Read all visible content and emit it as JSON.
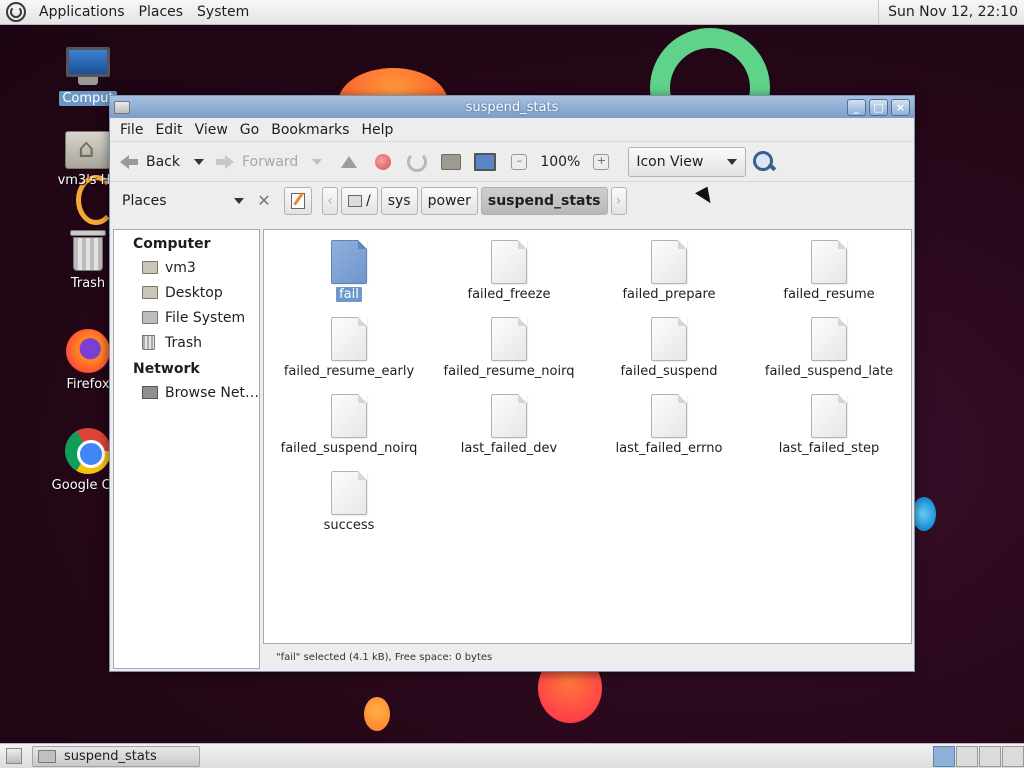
{
  "top_panel": {
    "menus": [
      "Applications",
      "Places",
      "System"
    ],
    "clock": "Sun Nov 12, 22:10"
  },
  "desktop": {
    "icons": [
      {
        "label": "Comput",
        "icon": "computer-icon"
      },
      {
        "label": "vm3's Ho",
        "icon": "home-folder-icon"
      },
      {
        "label": "Trash",
        "icon": "trash-icon"
      },
      {
        "label": "Firefox",
        "icon": "firefox-icon"
      },
      {
        "label": "Google Chr",
        "icon": "chrome-icon"
      }
    ]
  },
  "window": {
    "title": "suspend_stats",
    "menubar": [
      "File",
      "Edit",
      "View",
      "Go",
      "Bookmarks",
      "Help"
    ],
    "toolbar": {
      "back": "Back",
      "forward": "Forward",
      "zoom": "100%",
      "view_mode": "Icon View"
    },
    "location": {
      "places_label": "Places",
      "root": "/",
      "crumbs": [
        "sys",
        "power",
        "suspend_stats"
      ]
    },
    "sidebar": {
      "computer_heading": "Computer",
      "computer_items": [
        "vm3",
        "Desktop",
        "File System",
        "Trash"
      ],
      "network_heading": "Network",
      "network_items": [
        "Browse Net…"
      ]
    },
    "files": [
      {
        "name": "fail",
        "selected": true
      },
      {
        "name": "failed_freeze"
      },
      {
        "name": "failed_prepare"
      },
      {
        "name": "failed_resume"
      },
      {
        "name": "failed_resume_early"
      },
      {
        "name": "failed_resume_noirq"
      },
      {
        "name": "failed_suspend"
      },
      {
        "name": "failed_suspend_late"
      },
      {
        "name": "failed_suspend_noirq"
      },
      {
        "name": "last_failed_dev"
      },
      {
        "name": "last_failed_errno"
      },
      {
        "name": "last_failed_step"
      },
      {
        "name": "success"
      }
    ],
    "status": "\"fail\" selected (4.1 kB), Free space: 0 bytes"
  },
  "bottom_panel": {
    "task": "suspend_stats"
  }
}
